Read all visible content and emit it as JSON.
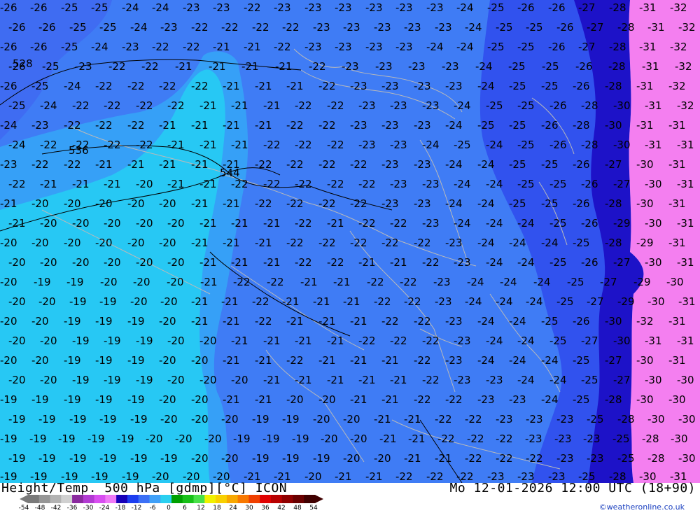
{
  "map": {
    "title_left": "Height/Temp. 500 hPa [gdmp][°C] ICON",
    "title_right": "Mo 12-01-2026 12:00 UTC (18+90)",
    "credit": "©weatheronline.co.uk",
    "colors": {
      "cyan": "#27c8f4",
      "light_blue": "#36a0f7",
      "blue": "#3f7cf5",
      "mid_blue": "#3152ee",
      "dark_blue": "#1d12c8",
      "magenta": "#f47ff0",
      "contour": "#000000",
      "border": "#b9b9b9"
    },
    "scale_labels": [
      "-54",
      "-48",
      "-42",
      "-36",
      "-30",
      "-24",
      "-18",
      "-12",
      "-6",
      "0",
      "6",
      "12",
      "18",
      "24",
      "30",
      "36",
      "42",
      "48",
      "54"
    ],
    "scale_colors": [
      "#7a7a7a",
      "#969696",
      "#b3b3b3",
      "#d0d0d0",
      "#8a2a9e",
      "#b23ad2",
      "#d84ef0",
      "#f07af6",
      "#1800b8",
      "#1d3ef0",
      "#3c70f6",
      "#3fa0f8",
      "#2ad0f0",
      "#00a000",
      "#18c018",
      "#48e048",
      "#f0f000",
      "#f8d000",
      "#f8a800",
      "#f87800",
      "#f04000",
      "#e00000",
      "#b80000",
      "#900000",
      "#6a0000",
      "#400000"
    ],
    "labels_note": "",
    "contour_labels": [
      {
        "t": "26",
        "v": "-26"
      },
      {
        "t": "25",
        "v": "-25"
      },
      {
        "t": "24",
        "v": "-24"
      },
      {
        "t": "23",
        "v": "-23"
      },
      {
        "t": "22",
        "v": "-22"
      },
      {
        "t": "21",
        "v": "-21"
      },
      {
        "t": "20",
        "v": "-20"
      },
      {
        "t": "19",
        "v": "-19"
      },
      {
        "t": "27",
        "v": "-27"
      },
      {
        "t": "28",
        "v": "-28"
      },
      {
        "t": "29",
        "v": "-29"
      },
      {
        "t": "30",
        "v": "-30"
      },
      {
        "t": "31",
        "v": "-31"
      },
      {
        "t": "32",
        "v": "-32"
      }
    ],
    "height_labels": [
      "528",
      "536",
      "544"
    ]
  }
}
